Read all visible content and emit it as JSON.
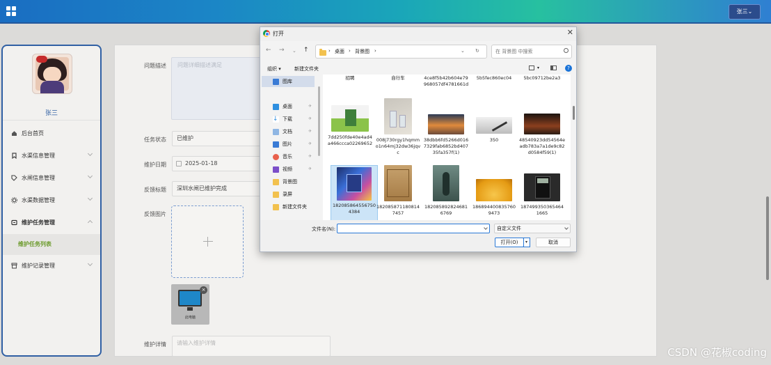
{
  "header": {
    "user_button": "张三⌄"
  },
  "sidebar": {
    "username": "张三",
    "items": [
      {
        "label": "后台首页"
      },
      {
        "label": "水渠信息管理"
      },
      {
        "label": "水闸信息管理"
      },
      {
        "label": "水渠数据管理"
      },
      {
        "label": "维护任务管理"
      },
      {
        "label": "维护任务列表"
      },
      {
        "label": "维护记录管理"
      }
    ]
  },
  "form": {
    "desc_label": "问题描述",
    "desc_placeholder": "问题详细描述满足",
    "status_label": "任务状态",
    "status_value": "已维护",
    "date_label": "维护日期",
    "date_value": "2025-01-18",
    "title_label": "反馈标题",
    "title_value": "深圳水闸已维护完成",
    "image_label": "反馈图片",
    "thumb_caption": "此电脑",
    "detail_label": "维护详情",
    "detail_placeholder": "请输入维护详情"
  },
  "dialog": {
    "title": "打开",
    "breadcrumb": [
      "桌面",
      "背景图"
    ],
    "search_placeholder": "在 背景图 中搜索",
    "organize": "组织 ▾",
    "new_folder": "新建文件夹",
    "nav_items": [
      {
        "label": "图库"
      },
      {
        "label": "桌面"
      },
      {
        "label": "下载"
      },
      {
        "label": "文档"
      },
      {
        "label": "图片"
      },
      {
        "label": "音乐"
      },
      {
        "label": "视频"
      },
      {
        "label": "背景图"
      },
      {
        "label": "录屏"
      },
      {
        "label": "新建文件夹"
      }
    ],
    "files_row0": [
      "招聘",
      "自行车",
      "4ce8f5b42b604e79968057df4781661d",
      "5b5fec860ec04",
      "5bc09712be2a3"
    ],
    "files_row1": [
      "7dd250fde40e4ad4a466ccca02269652",
      "008j730rgy1hqmmo1n64mj32dw36jqvc",
      "38dbb6fd5266d0167329fab6852bd40735fa357f(1)",
      "350",
      "48540923dd54564eadb783a7a1de9c82d0584f59(1)"
    ],
    "files_row2": [
      "1820858645567504384",
      "1820858711808147457",
      "1820858928246816769",
      "1868944008357609473",
      "1874993503654641665"
    ],
    "filename_label": "文件名(N):",
    "filter_value": "自定义文件",
    "open_button": "打开(O)",
    "cancel_button": "取消"
  },
  "watermark": "CSDN @花椒coding",
  "colors": {
    "header_start": "#1a6dc2",
    "header_mid": "#27c0a0",
    "accent_green": "#6b9a2b",
    "sidebar_border": "#2f5fa3"
  }
}
